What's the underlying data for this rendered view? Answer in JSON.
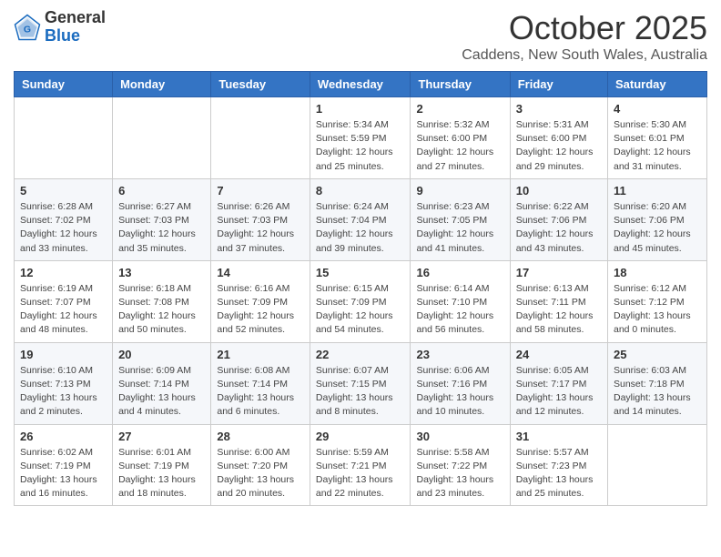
{
  "header": {
    "logo_line1": "General",
    "logo_line2": "Blue",
    "month": "October 2025",
    "location": "Caddens, New South Wales, Australia"
  },
  "weekdays": [
    "Sunday",
    "Monday",
    "Tuesday",
    "Wednesday",
    "Thursday",
    "Friday",
    "Saturday"
  ],
  "weeks": [
    [
      {
        "day": "",
        "info": ""
      },
      {
        "day": "",
        "info": ""
      },
      {
        "day": "",
        "info": ""
      },
      {
        "day": "1",
        "info": "Sunrise: 5:34 AM\nSunset: 5:59 PM\nDaylight: 12 hours\nand 25 minutes."
      },
      {
        "day": "2",
        "info": "Sunrise: 5:32 AM\nSunset: 6:00 PM\nDaylight: 12 hours\nand 27 minutes."
      },
      {
        "day": "3",
        "info": "Sunrise: 5:31 AM\nSunset: 6:00 PM\nDaylight: 12 hours\nand 29 minutes."
      },
      {
        "day": "4",
        "info": "Sunrise: 5:30 AM\nSunset: 6:01 PM\nDaylight: 12 hours\nand 31 minutes."
      }
    ],
    [
      {
        "day": "5",
        "info": "Sunrise: 6:28 AM\nSunset: 7:02 PM\nDaylight: 12 hours\nand 33 minutes."
      },
      {
        "day": "6",
        "info": "Sunrise: 6:27 AM\nSunset: 7:03 PM\nDaylight: 12 hours\nand 35 minutes."
      },
      {
        "day": "7",
        "info": "Sunrise: 6:26 AM\nSunset: 7:03 PM\nDaylight: 12 hours\nand 37 minutes."
      },
      {
        "day": "8",
        "info": "Sunrise: 6:24 AM\nSunset: 7:04 PM\nDaylight: 12 hours\nand 39 minutes."
      },
      {
        "day": "9",
        "info": "Sunrise: 6:23 AM\nSunset: 7:05 PM\nDaylight: 12 hours\nand 41 minutes."
      },
      {
        "day": "10",
        "info": "Sunrise: 6:22 AM\nSunset: 7:06 PM\nDaylight: 12 hours\nand 43 minutes."
      },
      {
        "day": "11",
        "info": "Sunrise: 6:20 AM\nSunset: 7:06 PM\nDaylight: 12 hours\nand 45 minutes."
      }
    ],
    [
      {
        "day": "12",
        "info": "Sunrise: 6:19 AM\nSunset: 7:07 PM\nDaylight: 12 hours\nand 48 minutes."
      },
      {
        "day": "13",
        "info": "Sunrise: 6:18 AM\nSunset: 7:08 PM\nDaylight: 12 hours\nand 50 minutes."
      },
      {
        "day": "14",
        "info": "Sunrise: 6:16 AM\nSunset: 7:09 PM\nDaylight: 12 hours\nand 52 minutes."
      },
      {
        "day": "15",
        "info": "Sunrise: 6:15 AM\nSunset: 7:09 PM\nDaylight: 12 hours\nand 54 minutes."
      },
      {
        "day": "16",
        "info": "Sunrise: 6:14 AM\nSunset: 7:10 PM\nDaylight: 12 hours\nand 56 minutes."
      },
      {
        "day": "17",
        "info": "Sunrise: 6:13 AM\nSunset: 7:11 PM\nDaylight: 12 hours\nand 58 minutes."
      },
      {
        "day": "18",
        "info": "Sunrise: 6:12 AM\nSunset: 7:12 PM\nDaylight: 13 hours\nand 0 minutes."
      }
    ],
    [
      {
        "day": "19",
        "info": "Sunrise: 6:10 AM\nSunset: 7:13 PM\nDaylight: 13 hours\nand 2 minutes."
      },
      {
        "day": "20",
        "info": "Sunrise: 6:09 AM\nSunset: 7:14 PM\nDaylight: 13 hours\nand 4 minutes."
      },
      {
        "day": "21",
        "info": "Sunrise: 6:08 AM\nSunset: 7:14 PM\nDaylight: 13 hours\nand 6 minutes."
      },
      {
        "day": "22",
        "info": "Sunrise: 6:07 AM\nSunset: 7:15 PM\nDaylight: 13 hours\nand 8 minutes."
      },
      {
        "day": "23",
        "info": "Sunrise: 6:06 AM\nSunset: 7:16 PM\nDaylight: 13 hours\nand 10 minutes."
      },
      {
        "day": "24",
        "info": "Sunrise: 6:05 AM\nSunset: 7:17 PM\nDaylight: 13 hours\nand 12 minutes."
      },
      {
        "day": "25",
        "info": "Sunrise: 6:03 AM\nSunset: 7:18 PM\nDaylight: 13 hours\nand 14 minutes."
      }
    ],
    [
      {
        "day": "26",
        "info": "Sunrise: 6:02 AM\nSunset: 7:19 PM\nDaylight: 13 hours\nand 16 minutes."
      },
      {
        "day": "27",
        "info": "Sunrise: 6:01 AM\nSunset: 7:19 PM\nDaylight: 13 hours\nand 18 minutes."
      },
      {
        "day": "28",
        "info": "Sunrise: 6:00 AM\nSunset: 7:20 PM\nDaylight: 13 hours\nand 20 minutes."
      },
      {
        "day": "29",
        "info": "Sunrise: 5:59 AM\nSunset: 7:21 PM\nDaylight: 13 hours\nand 22 minutes."
      },
      {
        "day": "30",
        "info": "Sunrise: 5:58 AM\nSunset: 7:22 PM\nDaylight: 13 hours\nand 23 minutes."
      },
      {
        "day": "31",
        "info": "Sunrise: 5:57 AM\nSunset: 7:23 PM\nDaylight: 13 hours\nand 25 minutes."
      },
      {
        "day": "",
        "info": ""
      }
    ]
  ]
}
